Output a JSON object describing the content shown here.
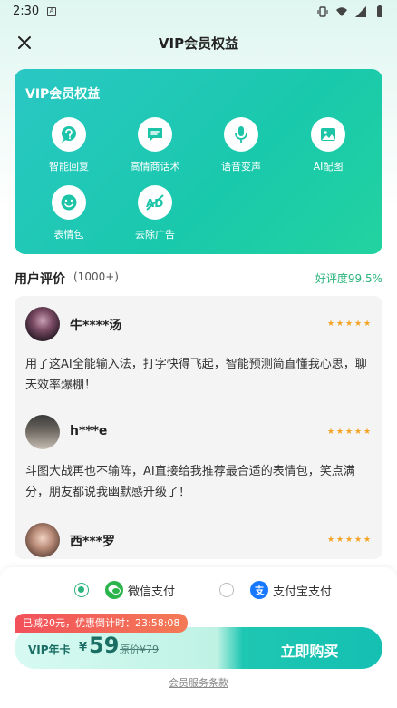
{
  "status_bar": {
    "time": "2:30",
    "notif_badge": "A"
  },
  "header": {
    "title": "VIP会员权益"
  },
  "benefits": {
    "title": "VIP会员权益",
    "items": [
      {
        "label": "智能回复",
        "icon": "question-bubble-icon"
      },
      {
        "label": "高情商话术",
        "icon": "chat-bubble-icon"
      },
      {
        "label": "语音变声",
        "icon": "microphone-icon"
      },
      {
        "label": "AI配图",
        "icon": "image-icon"
      },
      {
        "label": "表情包",
        "icon": "smiley-icon"
      },
      {
        "label": "去除广告",
        "icon": "no-ad-icon"
      }
    ]
  },
  "reviews": {
    "title": "用户评价",
    "count": "(1000+)",
    "rating": "好评度99.5%",
    "items": [
      {
        "name": "牛****汤",
        "text": "用了这AI全能输入法，打字快得飞起，智能预测简直懂我心思，聊天效率爆棚！",
        "stars": 5
      },
      {
        "name": "h***e",
        "text": "斗图大战再也不输阵，AI直接给我推荐最合适的表情包，笑点满分，朋友都说我幽默感升级了！",
        "stars": 5
      },
      {
        "name": "西***罗",
        "text": "",
        "stars": 5
      }
    ]
  },
  "payment": {
    "wechat_label": "微信支付",
    "alipay_label": "支付宝支付",
    "selected": "wechat"
  },
  "purchase": {
    "promo": "已减20元，优惠倒计时：23:58:08",
    "plan": "VIP年卡",
    "currency": "¥",
    "price": "59",
    "original": "原价¥79",
    "buy_label": "立即购买",
    "terms": "会员服务条款"
  },
  "colors": {
    "accent": "#19c9ab",
    "green": "#2bb47c",
    "star": "#f3a323",
    "promo": "#f2505a"
  }
}
